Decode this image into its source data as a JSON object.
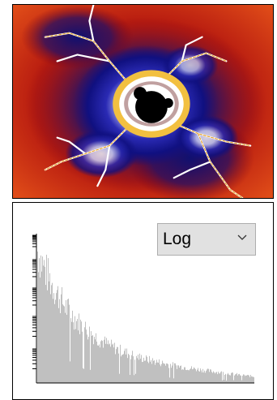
{
  "fractal_view": {
    "icon": "fractal-image",
    "colors": {
      "background_red": "#c0200f",
      "deep_blue": "#11117a",
      "glow_white": "#ffffff",
      "gold": "#f0b030",
      "set_black": "#000000"
    }
  },
  "histogram": {
    "scale_dropdown": {
      "selected": "Log"
    },
    "bar_color": "#c0c0c0"
  }
}
